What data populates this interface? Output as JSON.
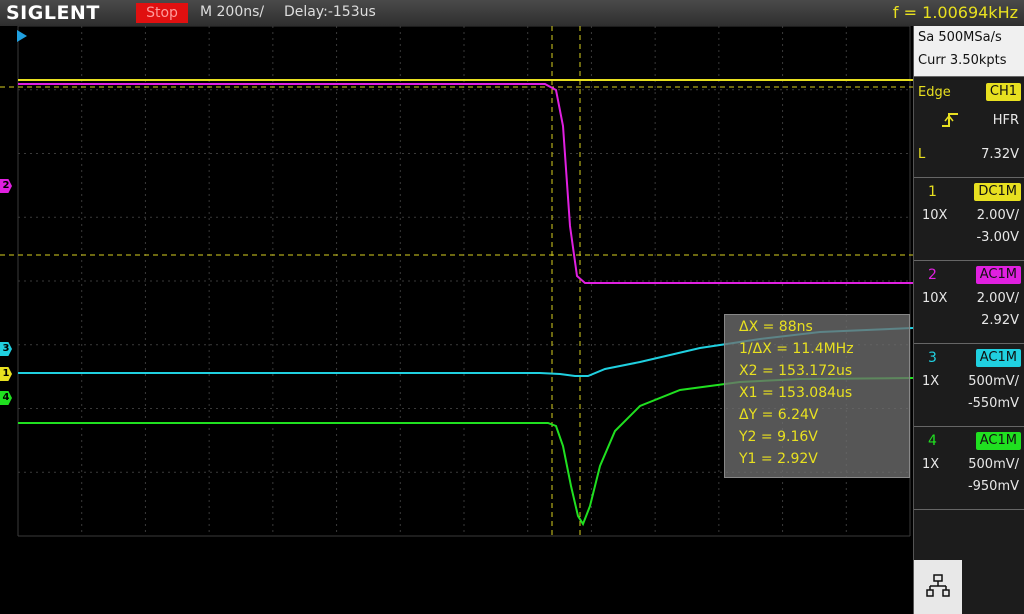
{
  "topbar": {
    "brand": "SIGLENT",
    "run_state": "Stop",
    "timebase": "M 200ns/",
    "delay": "Delay:-153us",
    "frequency": "f = 1.00694kHz"
  },
  "acquisition": {
    "sample_rate": "Sa 500MSa/s",
    "memory": "Curr 3.50kpts"
  },
  "trigger": {
    "type": "Edge",
    "source": "CH1",
    "coupling": "HFR",
    "level_label": "L",
    "level": "7.32V"
  },
  "channels": [
    {
      "num": "1",
      "coupling": "DC1M",
      "probe": "10X",
      "scale": "2.00V/",
      "offset": "-3.00V",
      "color": "#e8e020"
    },
    {
      "num": "2",
      "coupling": "AC1M",
      "probe": "10X",
      "scale": "2.00V/",
      "offset": "2.92V",
      "color": "#e020e0"
    },
    {
      "num": "3",
      "coupling": "AC1M",
      "probe": "1X",
      "scale": "500mV/",
      "offset": "-550mV",
      "color": "#20d0e0"
    },
    {
      "num": "4",
      "coupling": "AC1M",
      "probe": "1X",
      "scale": "500mV/",
      "offset": "-950mV",
      "color": "#20e020"
    }
  ],
  "cursors": {
    "delta_x": "ΔX = 88ns",
    "inv_delta_x": "1/ΔX = 11.4MHz",
    "x2": "X2 = 153.172us",
    "x1": "X1 = 153.084us",
    "delta_y": "ΔY = 6.24V",
    "y2": "Y2 = 9.16V",
    "y1": "Y1 = 2.92V"
  },
  "markers": {
    "ch1": "1",
    "ch2": "2",
    "ch3": "3",
    "ch4": "4"
  },
  "icons": {
    "network": "network-icon",
    "trigger_edge": "rising-edge-icon"
  }
}
